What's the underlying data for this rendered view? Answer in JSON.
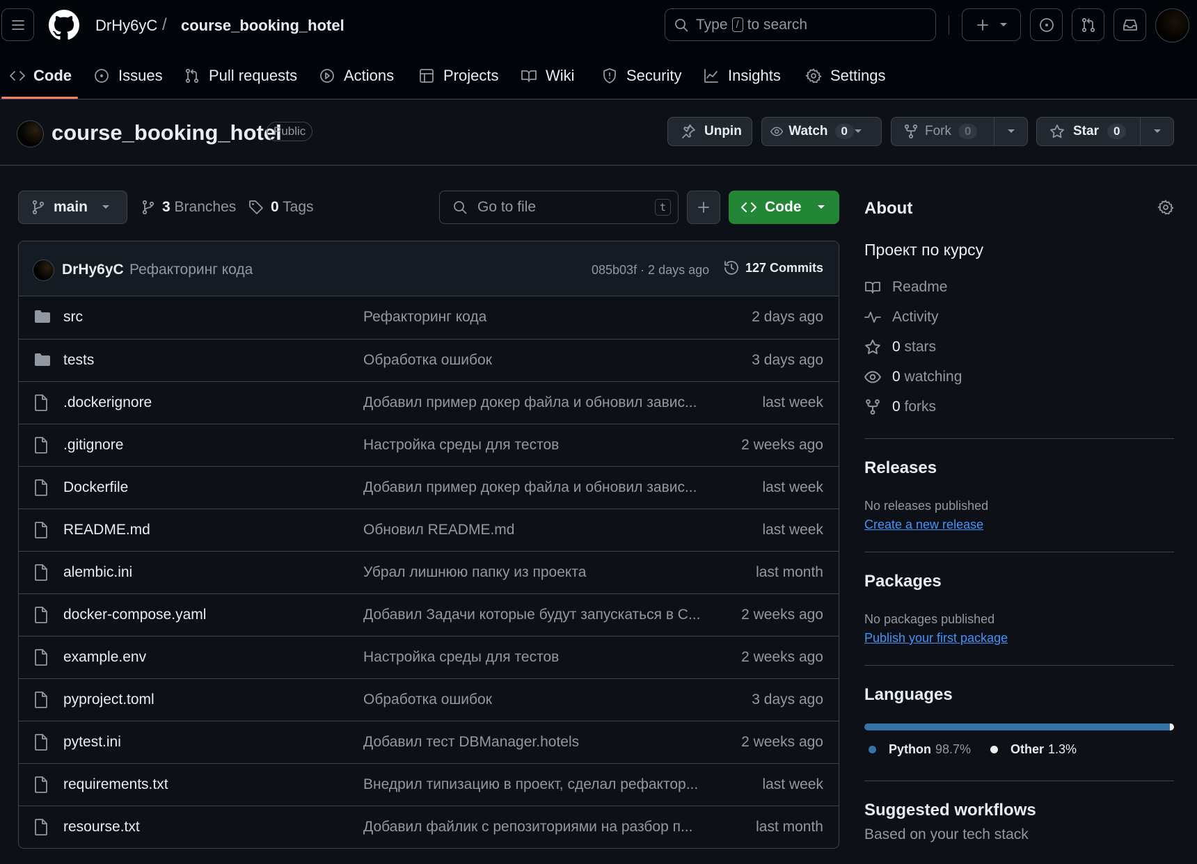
{
  "header": {
    "owner": "DrHy6yC",
    "separator": "/",
    "repo": "course_booking_hotel",
    "search_prefix": "Type",
    "search_key": "/",
    "search_suffix": "to search"
  },
  "tabs": [
    {
      "label": "Code",
      "icon": "code-icon",
      "active": true
    },
    {
      "label": "Issues",
      "icon": "issue-icon"
    },
    {
      "label": "Pull requests",
      "icon": "pull-request-icon"
    },
    {
      "label": "Actions",
      "icon": "play-icon"
    },
    {
      "label": "Projects",
      "icon": "table-icon"
    },
    {
      "label": "Wiki",
      "icon": "book-icon"
    },
    {
      "label": "Security",
      "icon": "shield-icon"
    },
    {
      "label": "Insights",
      "icon": "graph-icon"
    },
    {
      "label": "Settings",
      "icon": "gear-icon"
    }
  ],
  "repo": {
    "title": "course_booking_hotel",
    "visibility": "Public",
    "unpin_label": "Unpin",
    "watch_label": "Watch",
    "watch_count": "0",
    "fork_label": "Fork",
    "fork_count": "0",
    "star_label": "Star",
    "star_count": "0"
  },
  "toolbar": {
    "branch": "main",
    "branches_count": "3",
    "branches_label": "Branches",
    "tags_count": "0",
    "tags_label": "Tags",
    "goto_placeholder": "Go to file",
    "goto_key": "t",
    "code_label": "Code"
  },
  "commit": {
    "author": "DrHy6yC",
    "message": "Рефакторинг кода",
    "sha_time": "085b03f · 2 days ago",
    "commits_label": "127 Commits"
  },
  "files": [
    {
      "name": "src",
      "type": "dir",
      "message": "Рефакторинг кода",
      "date": "2 days ago"
    },
    {
      "name": "tests",
      "type": "dir",
      "message": "Обработка ошибок",
      "date": "3 days ago"
    },
    {
      "name": ".dockerignore",
      "type": "file",
      "message": "Добавил пример докер файла и обновил завис...",
      "date": "last week"
    },
    {
      "name": ".gitignore",
      "type": "file",
      "message": "Настройка среды для тестов",
      "date": "2 weeks ago"
    },
    {
      "name": "Dockerfile",
      "type": "file",
      "message": "Добавил пример докер файла и обновил завис...",
      "date": "last week"
    },
    {
      "name": "README.md",
      "type": "file",
      "message": "Обновил README.md",
      "date": "last week"
    },
    {
      "name": "alembic.ini",
      "type": "file",
      "message": "Убрал лишнюю папку из проекта",
      "date": "last month"
    },
    {
      "name": "docker-compose.yaml",
      "type": "file",
      "message": "Добавил Задачи которые будут запускаться в С...",
      "date": "2 weeks ago"
    },
    {
      "name": "example.env",
      "type": "file",
      "message": "Настройка среды для тестов",
      "date": "2 weeks ago"
    },
    {
      "name": "pyproject.toml",
      "type": "file",
      "message": "Обработка ошибок",
      "date": "3 days ago"
    },
    {
      "name": "pytest.ini",
      "type": "file",
      "message": "Добавил тест DBManager.hotels",
      "date": "2 weeks ago"
    },
    {
      "name": "requirements.txt",
      "type": "file",
      "message": "Внедрил типизацию в проект, сделал рефактор...",
      "date": "last week"
    },
    {
      "name": "resourse.txt",
      "type": "file",
      "message": "Добавил файлик с репозиториями на разбор п...",
      "date": "last month"
    }
  ],
  "about": {
    "title": "About",
    "description": "Проект по курсу",
    "readme": "Readme",
    "activity": "Activity",
    "stars_count": "0",
    "stars_label": "stars",
    "watching_count": "0",
    "watching_label": "watching",
    "forks_count": "0",
    "forks_label": "forks"
  },
  "releases": {
    "title": "Releases",
    "empty": "No releases published",
    "link": "Create a new release"
  },
  "packages": {
    "title": "Packages",
    "empty": "No packages published",
    "link": "Publish your first package"
  },
  "languages": {
    "title": "Languages",
    "items": [
      {
        "name": "Python",
        "percent": "98.7%",
        "value": 98.7,
        "color": "#3572A5"
      },
      {
        "name": "Other",
        "percent": "1.3%",
        "value": 1.3,
        "color": "#ededed"
      }
    ]
  },
  "workflows": {
    "title": "Suggested workflows",
    "subtitle": "Based on your tech stack"
  }
}
